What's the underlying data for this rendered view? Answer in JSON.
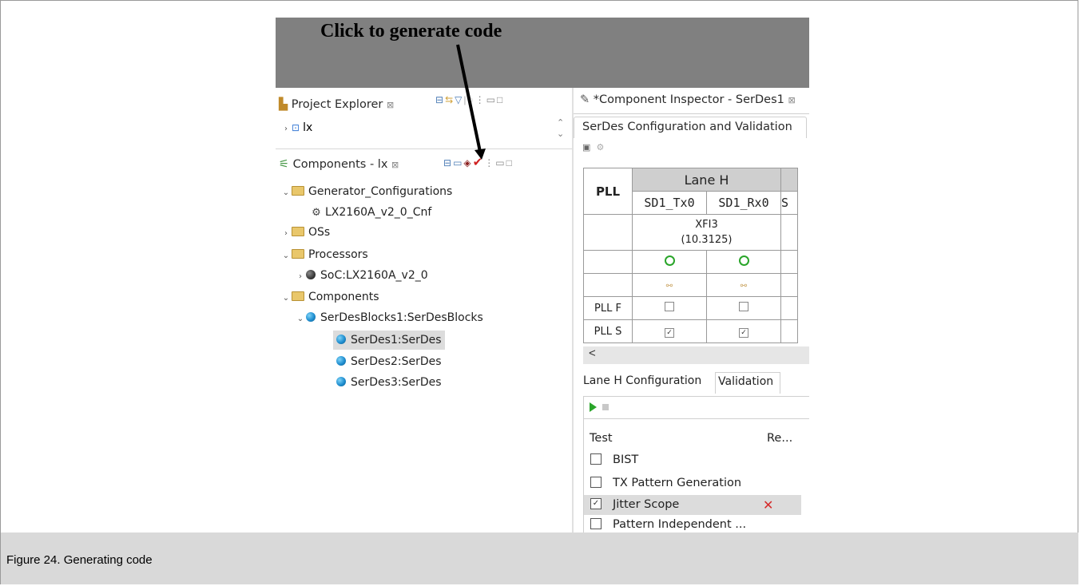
{
  "banner": {
    "text": "Click to generate code"
  },
  "project_explorer": {
    "title": "Project Explorer",
    "close_glyph": "⊠",
    "items": [
      {
        "label": "lx"
      }
    ]
  },
  "components": {
    "title": "Components - lx",
    "close_glyph": "⊠",
    "tree": [
      {
        "label": "Generator_Configurations"
      },
      {
        "label": "LX2160A_v2_0_Cnf"
      },
      {
        "label": "OSs"
      },
      {
        "label": "Processors"
      },
      {
        "label": "SoC:LX2160A_v2_0"
      },
      {
        "label": "Components"
      },
      {
        "label": "SerDesBlocks1:SerDesBlocks"
      },
      {
        "label": "SerDes1:SerDes"
      },
      {
        "label": "SerDes2:SerDes"
      },
      {
        "label": "SerDes3:SerDes"
      }
    ]
  },
  "inspector": {
    "tab_title": "*Component Inspector - SerDes1",
    "close_glyph": "⊠",
    "config_tab": "SerDes Configuration and Validation",
    "grid": {
      "pll_header": "PLL",
      "lane_header": "Lane H",
      "columns": [
        "SD1_Tx0",
        "SD1_Rx0",
        "S"
      ],
      "protocol_line1": "XFI3",
      "protocol_line2": "(10.3125)",
      "rows": [
        {
          "label": "PLL F",
          "tx": false,
          "rx": false
        },
        {
          "label": "PLL S",
          "tx": true,
          "rx": true
        }
      ]
    },
    "scroll_left": "<",
    "lower_tabs": [
      "Lane H Configuration",
      "Validation"
    ],
    "validation": {
      "col_test": "Test",
      "col_result": "Re...",
      "tests": [
        {
          "label": "BIST",
          "checked": false,
          "failed": false
        },
        {
          "label": "TX Pattern Generation",
          "checked": false,
          "failed": false
        },
        {
          "label": "Jitter Scope",
          "checked": true,
          "failed": true
        },
        {
          "label": "Pattern Independent ...",
          "checked": false,
          "failed": false
        }
      ]
    }
  },
  "caption": "Figure 24.  Generating code",
  "colors": {
    "banner_bg": "#808080",
    "caption_bg": "#d9d9d9",
    "selection_bg": "#dcdcdc",
    "fail_mark": "#d62a2a",
    "power_green": "#2aa52a"
  }
}
